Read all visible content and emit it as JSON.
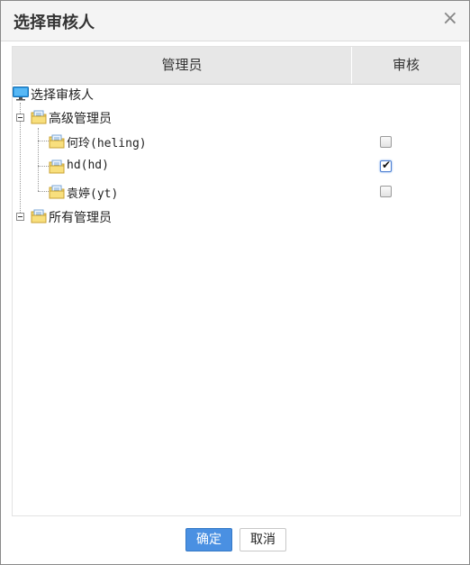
{
  "dialog": {
    "title": "选择审核人",
    "close_symbol": "×"
  },
  "table": {
    "col_manager": "管理员",
    "col_audit": "审核"
  },
  "tree": {
    "root": {
      "label": "选择审核人",
      "icon": "monitor-icon"
    },
    "groups": [
      {
        "label": "高级管理员",
        "icon": "folder-icon",
        "expanded": true,
        "children": [
          {
            "label": "何玲(heling)",
            "checked": false
          },
          {
            "label": "hd(hd)",
            "checked": true
          },
          {
            "label": "袁婷(yt)",
            "checked": false
          }
        ]
      },
      {
        "label": "所有管理员",
        "icon": "folder-icon",
        "expanded": true,
        "children": []
      }
    ]
  },
  "buttons": {
    "ok": "确定",
    "cancel": "取消"
  },
  "colors": {
    "primary": "#4a90e2",
    "header_bg": "#e7e7e7",
    "title_bg": "#f4f4f4"
  }
}
